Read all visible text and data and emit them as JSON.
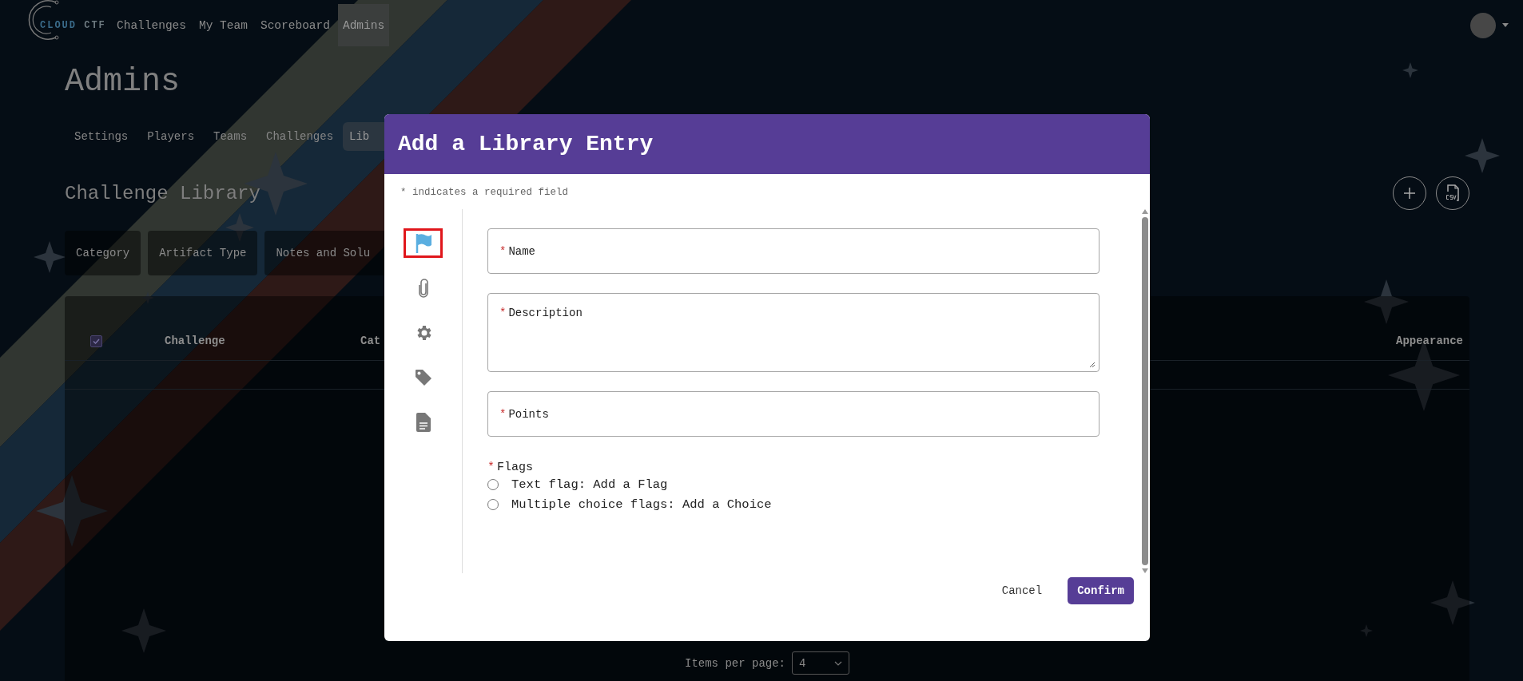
{
  "nav": {
    "logo": {
      "word_1": "CLOUD",
      "word_2": "CTF"
    },
    "items": [
      {
        "label": "Challenges",
        "selected": false
      },
      {
        "label": "My Team",
        "selected": false
      },
      {
        "label": "Scoreboard",
        "selected": false
      },
      {
        "label": "Admins",
        "selected": true
      }
    ]
  },
  "page_title": "Admins",
  "admin_tabs": [
    {
      "label": "Settings",
      "selected": false
    },
    {
      "label": "Players",
      "selected": false
    },
    {
      "label": "Teams",
      "selected": false
    },
    {
      "label": "Challenges",
      "selected": false
    },
    {
      "label": "Lib",
      "selected": true
    }
  ],
  "section_title": "Challenge Library",
  "filters": [
    {
      "label": "Category"
    },
    {
      "label": "Artifact Type"
    },
    {
      "label": "Notes and Solu"
    }
  ],
  "table": {
    "select_all_checked": true,
    "columns": [
      "Challenge",
      "Cat",
      "Appearance"
    ]
  },
  "pagination": {
    "label": "Items per page:",
    "value": "4"
  },
  "modal": {
    "title": "Add a Library Entry",
    "required_mark": "*",
    "required_note": "* indicates a required field",
    "sections": [
      {
        "kind": "flag",
        "selected": true
      },
      {
        "kind": "attachment",
        "selected": false
      },
      {
        "kind": "settings",
        "selected": false
      },
      {
        "kind": "tag",
        "selected": false
      },
      {
        "kind": "document",
        "selected": false
      }
    ],
    "fields": [
      {
        "label": "Name",
        "kind": "input",
        "required": true
      },
      {
        "label": "Description",
        "kind": "textarea",
        "required": true
      },
      {
        "label": "Points",
        "kind": "input",
        "required": true
      }
    ],
    "flags": {
      "label": "Flags",
      "required": true,
      "options": [
        {
          "label": "Text flag: Add a Flag",
          "selected": false
        },
        {
          "label": "Multiple choice flags: Add a Choice",
          "selected": false
        }
      ]
    },
    "buttons": [
      {
        "label": "Cancel",
        "kind": "text"
      },
      {
        "label": "Confirm",
        "kind": "primary"
      }
    ]
  }
}
